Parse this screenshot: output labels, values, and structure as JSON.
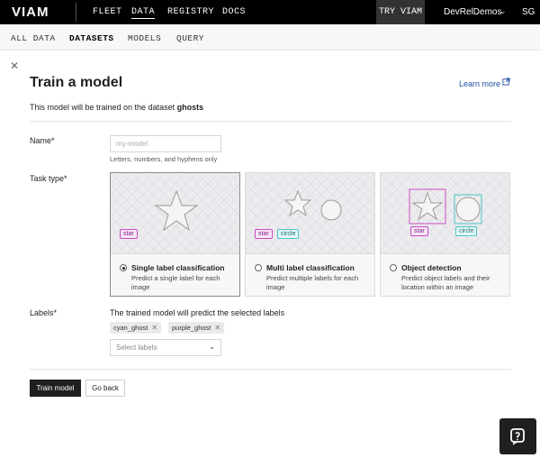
{
  "header": {
    "logo": "VIAM",
    "nav": [
      "FLEET",
      "DATA",
      "REGISTRY",
      "DOCS"
    ],
    "active_nav": "DATA",
    "try_button": "TRY VIAM",
    "org_name": "DevRelDemos",
    "user_initials": "SG"
  },
  "subnav": {
    "items": [
      "ALL DATA",
      "DATASETS",
      "MODELS",
      "QUERY"
    ],
    "active": "DATASETS"
  },
  "page": {
    "title": "Train a model",
    "learn_more": "Learn more",
    "description_prefix": "This model will be trained on the dataset",
    "dataset_name": "ghosts"
  },
  "form": {
    "name_label": "Name*",
    "name_placeholder": "my-model",
    "name_help": "Letters, numbers, and hyphens only",
    "task_label": "Task type*",
    "task_types": [
      {
        "title": "Single label classification",
        "description": "Predict a single label for each image",
        "selected": true,
        "tags": [
          "star"
        ]
      },
      {
        "title": "Multi label classification",
        "description": "Predict multiple labels for each image",
        "selected": false,
        "tags": [
          "star",
          "circle"
        ]
      },
      {
        "title": "Object detection",
        "description": "Predict object labels and their location within an image",
        "selected": false,
        "tags": [
          "star",
          "circle"
        ]
      }
    ],
    "labels_label": "Labels*",
    "labels_help": "The trained model will predict the selected labels",
    "selected_labels": [
      "cyan_ghost",
      "purple_ghost"
    ],
    "select_placeholder": "Select labels"
  },
  "actions": {
    "train_button": "Train model",
    "back_button": "Go back"
  },
  "colors": {
    "header_bg": "#000000",
    "tag_pink": "#c74cc7",
    "tag_cyan": "#48c6c6",
    "link": "#1f4fa0"
  }
}
